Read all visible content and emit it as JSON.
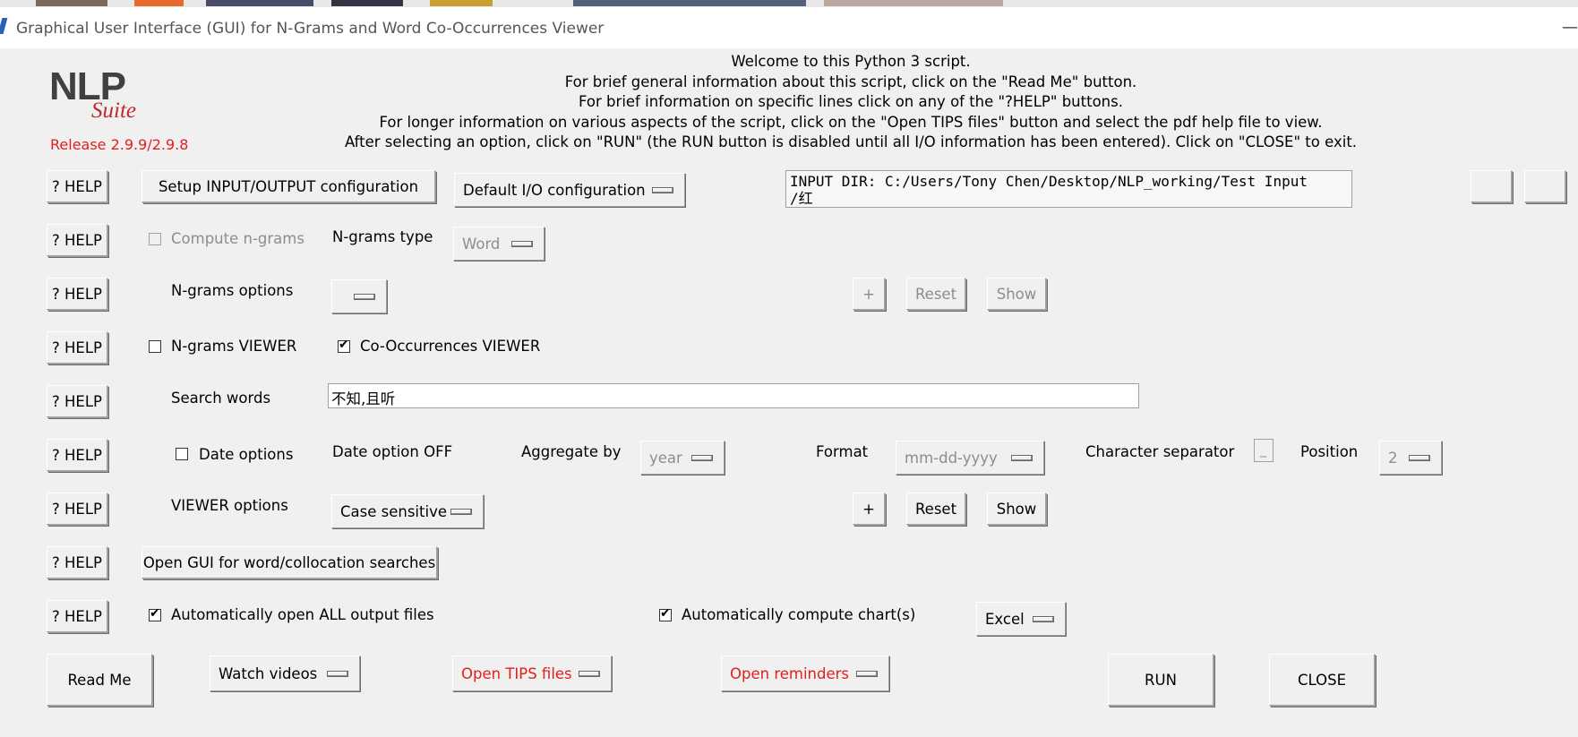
{
  "window": {
    "title": "Graphical User Interface (GUI) for N-Grams and Word Co-Occurrences Viewer",
    "minimize_glyph": "—"
  },
  "logo": {
    "main": "NLP",
    "sub": "Suite",
    "release": "Release 2.9.9/2.9.8"
  },
  "welcome_lines": [
    "Welcome to this Python 3 script.",
    "For brief general information about this script, click on the \"Read Me\" button.",
    "For brief information on specific lines click on any of the \"?HELP\" buttons.",
    "For longer information on various aspects of the script, click on the \"Open TIPS files\" button and select the pdf help file to view.",
    "After selecting an option, click on \"RUN\" (the RUN button is disabled until all I/O information has been entered).   Click on \"CLOSE\" to exit."
  ],
  "help_label": "? HELP",
  "io": {
    "setup_button": "Setup INPUT/OUTPUT configuration",
    "config_menu": "Default I/O configuration",
    "input_dir": "INPUT DIR: C:/Users/Tony Chen/Desktop/NLP_working/Test Input\n/红"
  },
  "ngrams": {
    "compute_label": "Compute n-grams",
    "compute_checked": false,
    "type_label": "N-grams type",
    "type_value": "Word",
    "options_label": "N-grams options",
    "options_value": "",
    "plus": "+",
    "reset": "Reset",
    "show": "Show"
  },
  "viewers": {
    "ngrams_viewer_label": "N-grams VIEWER",
    "ngrams_viewer_checked": false,
    "cooc_viewer_label": "Co-Occurrences VIEWER",
    "cooc_viewer_checked": true
  },
  "search": {
    "label": "Search words",
    "value": "不知,且听"
  },
  "date": {
    "label": "Date options",
    "checked": false,
    "status": "Date option OFF",
    "aggregate_label": "Aggregate by",
    "aggregate_value": "year",
    "format_label": "Format",
    "format_value": "mm-dd-yyyy",
    "separator_label": "Character separator",
    "separator_value": "_",
    "position_label": "Position",
    "position_value": "2"
  },
  "viewer_options": {
    "label": "VIEWER options",
    "value": "Case sensitive",
    "plus": "+",
    "reset": "Reset",
    "show": "Show"
  },
  "gui_button": "Open GUI for word/collocation searches",
  "output": {
    "open_all_label": "Automatically open ALL output files",
    "open_all_checked": true,
    "charts_label": "Automatically compute chart(s)",
    "charts_checked": true,
    "chart_engine": "Excel"
  },
  "bottom": {
    "read_me": "Read Me",
    "watch_videos": "Watch videos",
    "tips": "Open TIPS files",
    "reminders": "Open reminders",
    "run": "RUN",
    "close": "CLOSE"
  },
  "colors": {
    "red": "#e0201c",
    "background": "#f0f0f0"
  }
}
